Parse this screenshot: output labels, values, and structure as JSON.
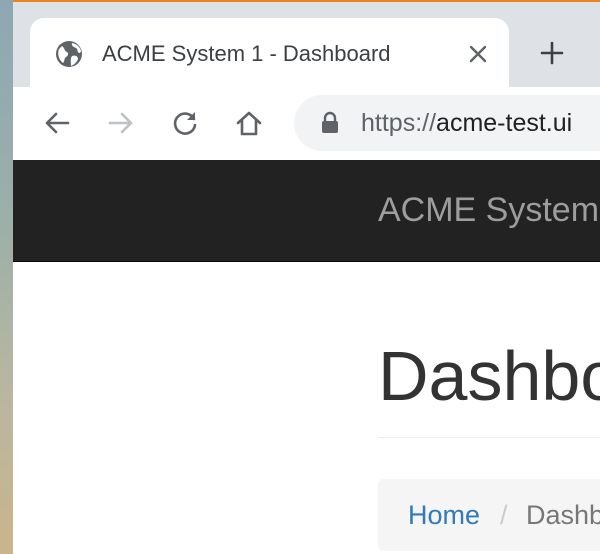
{
  "browser": {
    "tab": {
      "title": "ACME System 1 - Dashboard",
      "favicon": "globe-icon",
      "close_icon": "close-icon"
    },
    "new_tab_icon": "plus-icon",
    "toolbar": {
      "back_icon": "arrow-left-icon",
      "forward_icon": "arrow-right-icon",
      "reload_icon": "reload-icon",
      "home_icon": "home-icon"
    },
    "address_bar": {
      "lock_icon": "lock-icon",
      "scheme": "https://",
      "host": "acme-test.ui"
    }
  },
  "page": {
    "brand": "ACME System",
    "title": "Dashboard",
    "breadcrumb": {
      "home": "Home",
      "separator": "/",
      "current": "Dashboard"
    }
  },
  "colors": {
    "accent_line": "#e8841d",
    "navbar_bg": "#222222",
    "brand_text": "#9d9d9d",
    "link": "#337ab7"
  }
}
